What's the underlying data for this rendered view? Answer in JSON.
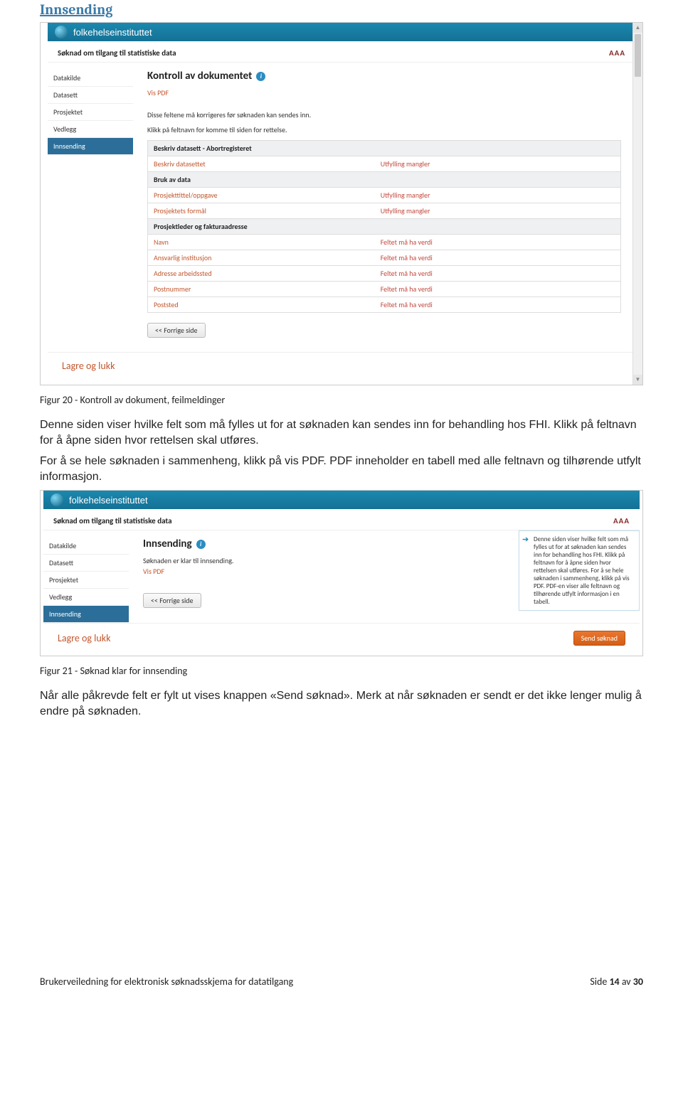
{
  "doc": {
    "section_title": "Innsending",
    "caption1": "Figur 20 - Kontroll av dokument, feilmeldinger",
    "para1": "Denne siden viser hvilke felt som må fylles ut for at søknaden kan sendes inn for behandling hos FHI. Klikk på feltnavn for å åpne siden hvor rettelsen skal utføres.",
    "para2": "For å se hele søknaden i sammenheng, klikk på vis PDF. PDF inneholder en tabell med alle feltnavn og tilhørende utfylt informasjon.",
    "caption2": "Figur 21 - Søknad klar for innsending",
    "para3": "Når alle påkrevde felt er fylt ut vises knappen «Send søknad». Merk at når søknaden er sendt er det ikke lenger mulig å endre på søknaden.",
    "footer_left": "Brukerveiledning for elektronisk søknadsskjema for datatilgang",
    "footer_right_a": "Side ",
    "footer_right_b": "14",
    "footer_right_c": " av ",
    "footer_right_d": "30"
  },
  "shared": {
    "brand": "folkehelseinstituttet",
    "crumb": "Søknad om tilgang til statistiske data",
    "aaa": "AAA",
    "sidebar": [
      "Datakilde",
      "Datasett",
      "Prosjektet",
      "Vedlegg",
      "Innsending"
    ],
    "vis_pdf": "Vis PDF",
    "prev_btn": "<< Forrige side",
    "lagre": "Lagre og lukk"
  },
  "shot1": {
    "page_heading": "Kontroll av dokumentet",
    "note1": "Disse feltene må korrigeres før søknaden kan sendes inn.",
    "note2": "Klikk på feltnavn for komme til siden for rettelse.",
    "sections": [
      {
        "head": "Beskriv datasett - Abortregisteret",
        "rows": [
          {
            "field": "Beskriv datasettet",
            "msg": "Utfylling mangler"
          }
        ]
      },
      {
        "head": "Bruk av data",
        "rows": [
          {
            "field": "Prosjekttittel/oppgave",
            "msg": "Utfylling mangler"
          },
          {
            "field": "Prosjektets formål",
            "msg": "Utfylling mangler"
          }
        ]
      },
      {
        "head": "Prosjektleder og fakturaadresse",
        "rows": [
          {
            "field": "Navn",
            "msg": "Feltet må ha verdi"
          },
          {
            "field": "Ansvarlig institusjon",
            "msg": "Feltet må ha verdi"
          },
          {
            "field": "Adresse arbeidssted",
            "msg": "Feltet må ha verdi"
          },
          {
            "field": "Postnummer",
            "msg": "Feltet må ha verdi"
          },
          {
            "field": "Poststed",
            "msg": "Feltet må ha verdi"
          }
        ]
      }
    ]
  },
  "shot2": {
    "page_heading": "Innsending",
    "ready_text": "Søknaden er klar til innsending.",
    "tooltip": "Denne siden viser hvilke felt som må fylles ut for at søknaden kan sendes inn for behandling hos FHI. Klikk på feltnavn for å åpne siden hvor rettelsen skal utføres. For å se hele søknaden i sammenheng, klikk på vis PDF. PDF-en viser alle feltnavn og tilhørende utfylt informasjon i en tabell.",
    "send_btn": "Send søknad"
  }
}
